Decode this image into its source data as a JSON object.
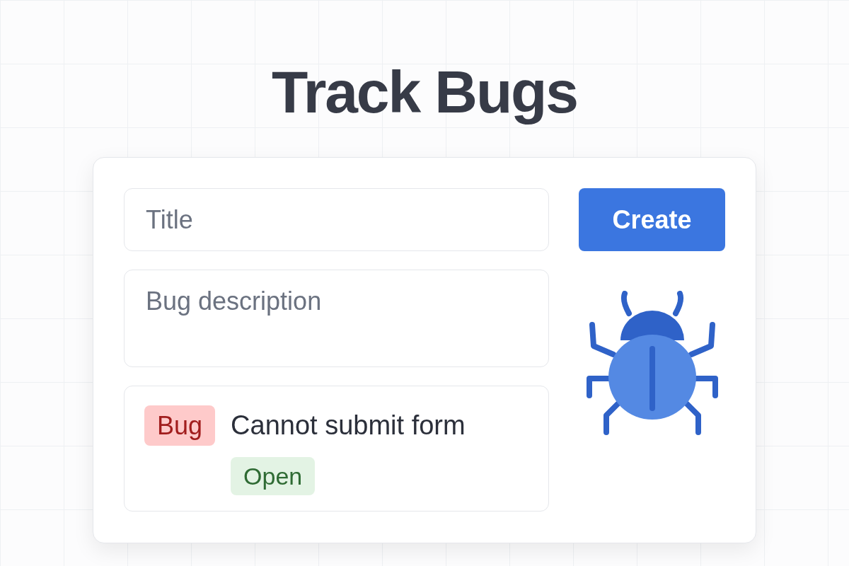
{
  "heading": "Track Bugs",
  "form": {
    "title_placeholder": "Title",
    "description_placeholder": "Bug description",
    "create_button": "Create"
  },
  "bugs": [
    {
      "tag": "Bug",
      "title": "Cannot submit form",
      "status": "Open"
    }
  ]
}
